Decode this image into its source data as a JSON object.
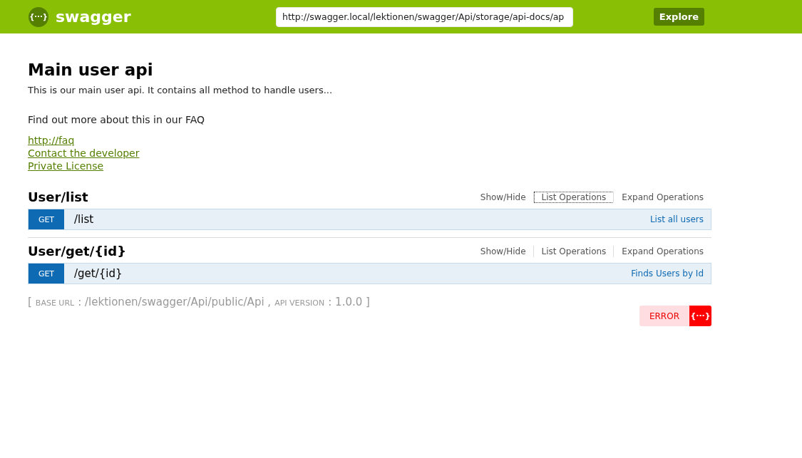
{
  "header": {
    "logo_glyph": "{···}",
    "brand": "swagger",
    "url": "http://swagger.local/lektionen/swagger/Api/storage/api-docs/ap",
    "button": "Explore"
  },
  "info": {
    "title": "Main user api",
    "description": "This is our main user api. It contains all method to handle users...",
    "more": "Find out more about this in our FAQ",
    "links": [
      "http://faq",
      "Contact the developer",
      "Private License"
    ]
  },
  "resources": [
    {
      "name": "User/list",
      "actions": [
        {
          "label": "Show/Hide",
          "focused": false
        },
        {
          "label": "List Operations",
          "focused": true
        },
        {
          "label": "Expand Operations",
          "focused": false
        }
      ],
      "operations": [
        {
          "method": "GET",
          "path": "/list",
          "summary": "List all users"
        }
      ]
    },
    {
      "name": "User/get/{id}",
      "actions": [
        {
          "label": "Show/Hide",
          "focused": false
        },
        {
          "label": "List Operations",
          "focused": false
        },
        {
          "label": "Expand Operations",
          "focused": false
        }
      ],
      "operations": [
        {
          "method": "GET",
          "path": "/get/{id}",
          "summary": "Finds Users by Id"
        }
      ]
    }
  ],
  "footer": {
    "open": "[",
    "base_label": "BASE URL",
    "base_value": ": /lektionen/swagger/Api/public/Api ,",
    "version_label": "API VERSION",
    "version_value": ": 1.0.0 ]",
    "validator": {
      "status": "ERROR",
      "glyph": "{···}"
    }
  }
}
